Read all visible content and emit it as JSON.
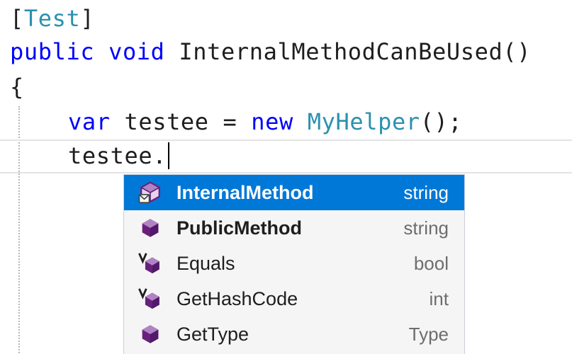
{
  "editor": {
    "attribute": {
      "open": "[",
      "name": "Test",
      "close": "]"
    },
    "method_signature": {
      "kw1": "public",
      "kw2": "void",
      "name": "InternalMethodCanBeUsed()"
    },
    "open_brace": "{",
    "line4": {
      "kw_var": "var",
      "mid": " testee = ",
      "kw_new": "new",
      "type": "MyHelper",
      "tail": "();"
    },
    "line5": {
      "text": "testee."
    }
  },
  "completion": {
    "items": [
      {
        "label": "InternalMethod",
        "type": "string",
        "icon": "internal-method-icon"
      },
      {
        "label": "PublicMethod",
        "type": "string",
        "icon": "method-icon"
      },
      {
        "label": "Equals",
        "type": "bool",
        "icon": "virtual-method-icon"
      },
      {
        "label": "GetHashCode",
        "type": "int",
        "icon": "virtual-method-icon"
      },
      {
        "label": "GetType",
        "type": "Type",
        "icon": "method-icon"
      }
    ]
  },
  "colors": {
    "keyword": "#0000ff",
    "type": "#2b91af",
    "selection": "#0078d7",
    "method_icon": "#68217a"
  }
}
